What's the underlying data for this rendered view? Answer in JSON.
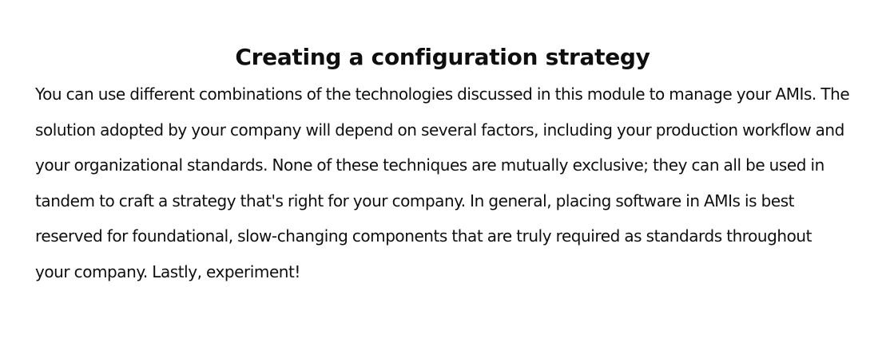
{
  "section": {
    "title": "Creating a configuration strategy",
    "body": "You can use different combinations of the technologies discussed in this module to manage your AMIs. The solution adopted by your company will depend on several factors, including your production workflow and your organizational standards. None of these techniques are mutually exclusive; they can all be used in tandem to craft a strategy that's right for your company. In general, placing software in AMIs is best reserved for foundational, slow-changing components that are truly required as standards throughout your company. Lastly, experiment!"
  }
}
